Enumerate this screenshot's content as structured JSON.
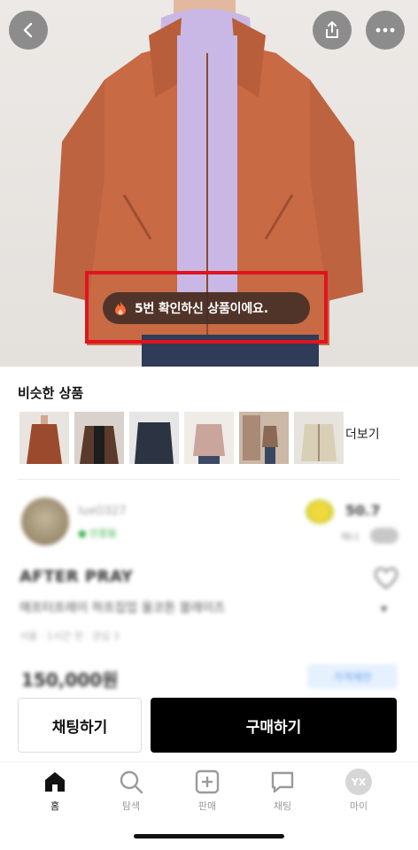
{
  "hero": {
    "view_count_message": "5번 확인하신 상품이에요.",
    "icons": {
      "back": "chevron-left-icon",
      "share": "share-icon",
      "more": "more-dots-icon",
      "fire": "fire-icon"
    }
  },
  "similar": {
    "title": "비슷한 상품",
    "more_label": "더보기",
    "thumbs": [
      {
        "colors": [
          "#9c4a2e",
          "#e9e4df"
        ]
      },
      {
        "colors": [
          "#5a3a2b",
          "#d9d2cc"
        ]
      },
      {
        "colors": [
          "#2c3443",
          "#e6e6e6"
        ]
      },
      {
        "colors": [
          "#c9a59b",
          "#efebe6"
        ]
      },
      {
        "colors": [
          "#8a6a55",
          "#cbb8a6"
        ]
      },
      {
        "colors": [
          "#d9cfb6",
          "#e7e4df"
        ]
      }
    ]
  },
  "seller": {
    "name": "luxO327",
    "badge": "● 인증됨",
    "rating": "50.7",
    "rating_sub": "매너"
  },
  "product": {
    "title": "AFTER PRAY",
    "description": "애프터프레이 하프집업 울코튼 블레이즈",
    "meta": "서울 · 1시간 전 · 관심 3",
    "price": "150,000원",
    "offer_label": "가격제안"
  },
  "actions": {
    "chat_label": "채팅하기",
    "buy_label": "구매하기"
  },
  "tabs": [
    {
      "label": "홈",
      "icon": "home-icon",
      "active": true
    },
    {
      "label": "탐색",
      "icon": "search-icon",
      "active": false
    },
    {
      "label": "판매",
      "icon": "plus-square-icon",
      "active": false
    },
    {
      "label": "채팅",
      "icon": "chat-bubble-icon",
      "active": false
    },
    {
      "label": "마이",
      "icon": "avatar-icon",
      "avatar_text": "YX",
      "active": false
    }
  ],
  "colors": {
    "highlight_border": "#e0141e",
    "buy_button": "#000000",
    "jacket": "#c86a44",
    "turtleneck": "#c9b8e6"
  }
}
